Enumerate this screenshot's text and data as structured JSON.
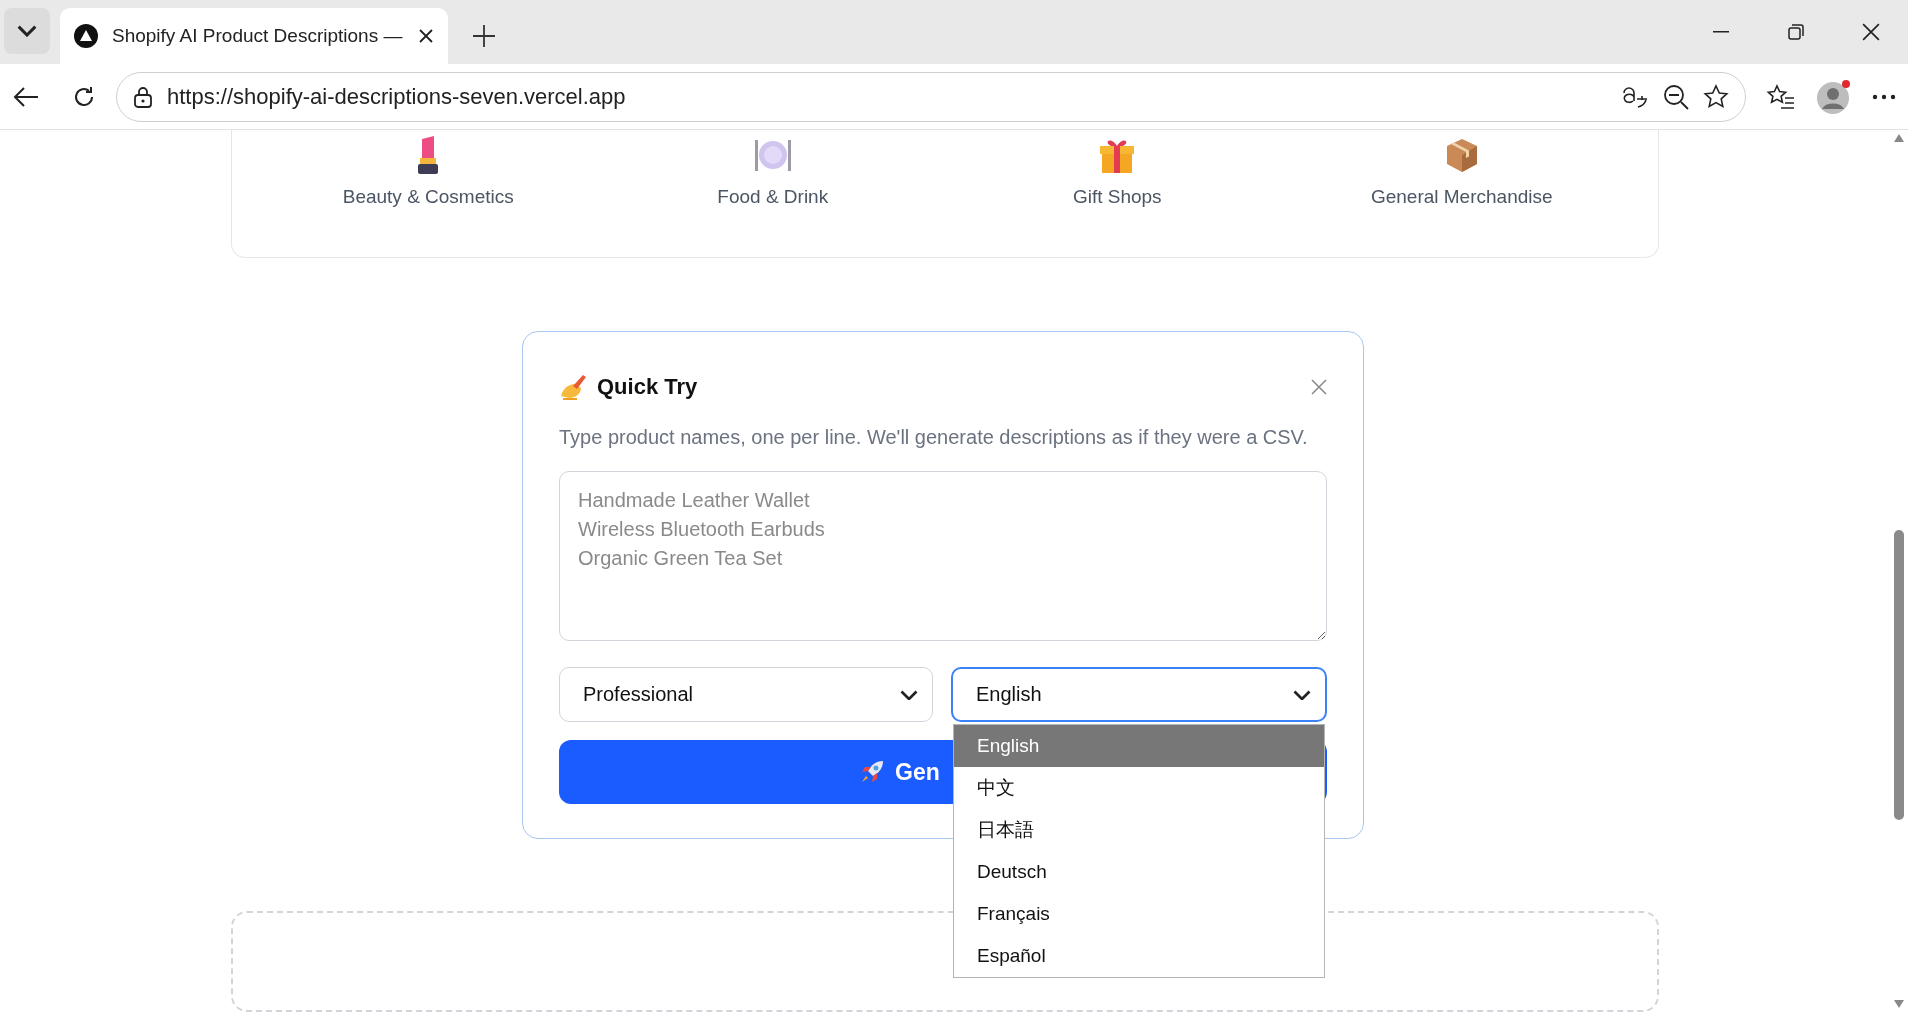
{
  "browser": {
    "tab_title": "Shopify AI Product Descriptions —",
    "url": "https://shopify-ai-descriptions-seven.vercel.app"
  },
  "categories": [
    {
      "label": "Beauty & Cosmetics",
      "kind": "lipstick"
    },
    {
      "label": "Food & Drink",
      "kind": "plate"
    },
    {
      "label": "Gift Shops",
      "kind": "gift"
    },
    {
      "label": "General Merchandise",
      "kind": "box"
    }
  ],
  "quick_try": {
    "title": "Quick Try",
    "description": "Type product names, one per line. We'll generate descriptions as if they were a CSV.",
    "products": {
      "placeholder": "Handmade Leather Wallet\nWireless Bluetooth Earbuds\nOrganic Green Tea Set"
    },
    "tone": {
      "value": "Professional",
      "focused": false
    },
    "language": {
      "value": "English",
      "focused": true,
      "open": true,
      "options": [
        {
          "label": "English",
          "selected": true
        },
        {
          "label": "中文",
          "selected": false
        },
        {
          "label": "日本語",
          "selected": false
        },
        {
          "label": "Deutsch",
          "selected": false
        },
        {
          "label": "Français",
          "selected": false
        },
        {
          "label": "Español",
          "selected": false
        }
      ]
    },
    "generate_button": {
      "label": "Gen"
    }
  }
}
